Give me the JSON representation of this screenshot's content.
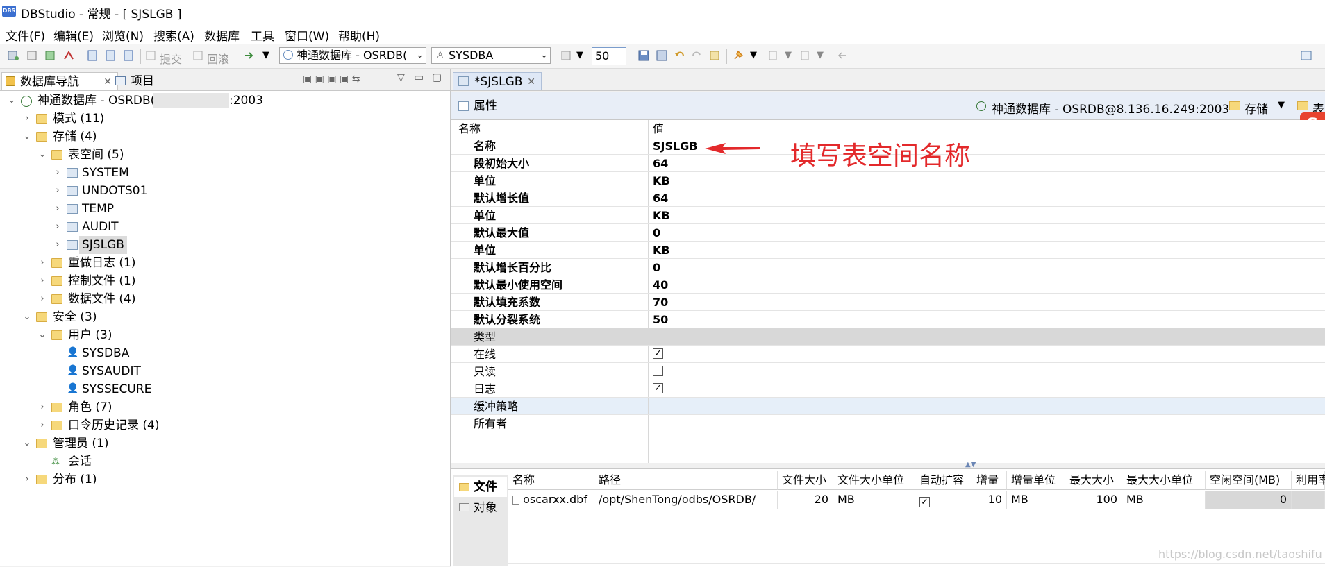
{
  "window": {
    "title": "DBStudio - 常规 - [ SJSLGB ]",
    "logo_text": "DBS"
  },
  "menu": [
    "文件(F)",
    "编辑(E)",
    "浏览(N)",
    "搜索(A)",
    "数据库",
    "工具",
    "窗口(W)",
    "帮助(H)"
  ],
  "toolbar": {
    "commit_label": "提交",
    "rollback_label": "回滚",
    "database_combo": "神通数据库 - OSRDB(",
    "user_combo": "SYSDBA",
    "rows_value": "50"
  },
  "left_panel": {
    "tab_nav": "数据库导航",
    "tab_project": "项目",
    "tree": {
      "root": "神通数据库 - OSRDB(",
      "root_suffix": ":2003",
      "schema": "模式 (11)",
      "storage": "存储 (4)",
      "tablespaces": "表空间 (5)",
      "ts_items": [
        "SYSTEM",
        "UNDOTS01",
        "TEMP",
        "AUDIT",
        "SJSLGB"
      ],
      "redo": "重做日志 (1)",
      "control": "控制文件 (1)",
      "datafiles": "数据文件 (4)",
      "security": "安全 (3)",
      "users": "用户 (3)",
      "user_items": [
        "SYSDBA",
        "SYSAUDIT",
        "SYSSECURE"
      ],
      "roles": "角色 (7)",
      "pwd_history": "口令历史记录 (4)",
      "admin": "管理员 (1)",
      "session": "会话",
      "distribution": "分布 (1)"
    }
  },
  "editor": {
    "tab": "*SJSLGB",
    "prop_tab": "属性",
    "connection": "神通数据库 - OSRDB@8.136.16.249:2003",
    "storage_label": "存储",
    "table_label": "表",
    "header_name": "名称",
    "header_value": "值",
    "props": [
      {
        "name": "名称",
        "value": "SJSLGB"
      },
      {
        "name": "段初始大小",
        "value": "64"
      },
      {
        "name": "单位",
        "value": "KB"
      },
      {
        "name": "默认增长值",
        "value": "64"
      },
      {
        "name": "单位",
        "value": "KB"
      },
      {
        "name": "默认最大值",
        "value": "0"
      },
      {
        "name": "单位",
        "value": "KB"
      },
      {
        "name": "默认增长百分比",
        "value": "0"
      },
      {
        "name": "默认最小使用空间",
        "value": "40"
      },
      {
        "name": "默认填充系数",
        "value": "70"
      },
      {
        "name": "默认分裂系统",
        "value": "50"
      }
    ],
    "type_section": "类型",
    "flags": [
      {
        "name": "在线",
        "checked": true
      },
      {
        "name": "只读",
        "checked": false
      },
      {
        "name": "日志",
        "checked": true
      }
    ],
    "cache_policy": "缓冲策略",
    "owner": "所有者",
    "annotation": "填写表空间名称"
  },
  "bottom": {
    "side_tabs": [
      "文件",
      "对象"
    ],
    "columns": [
      "名称",
      "路径",
      "文件大小",
      "文件大小单位",
      "自动扩容",
      "增量",
      "增量单位",
      "最大大小",
      "最大大小单位",
      "空闲空间(MB)",
      "利用率"
    ],
    "rows": [
      {
        "name": "oscarxx.dbf",
        "path": "/opt/ShenTong/odbs/OSRDB/",
        "size": "20",
        "size_unit": "MB",
        "auto_extend": true,
        "increment": "10",
        "increment_unit": "MB",
        "max_size": "100",
        "max_unit": "MB",
        "free": "0"
      }
    ]
  },
  "watermark": "https://blog.csdn.net/taoshifu"
}
